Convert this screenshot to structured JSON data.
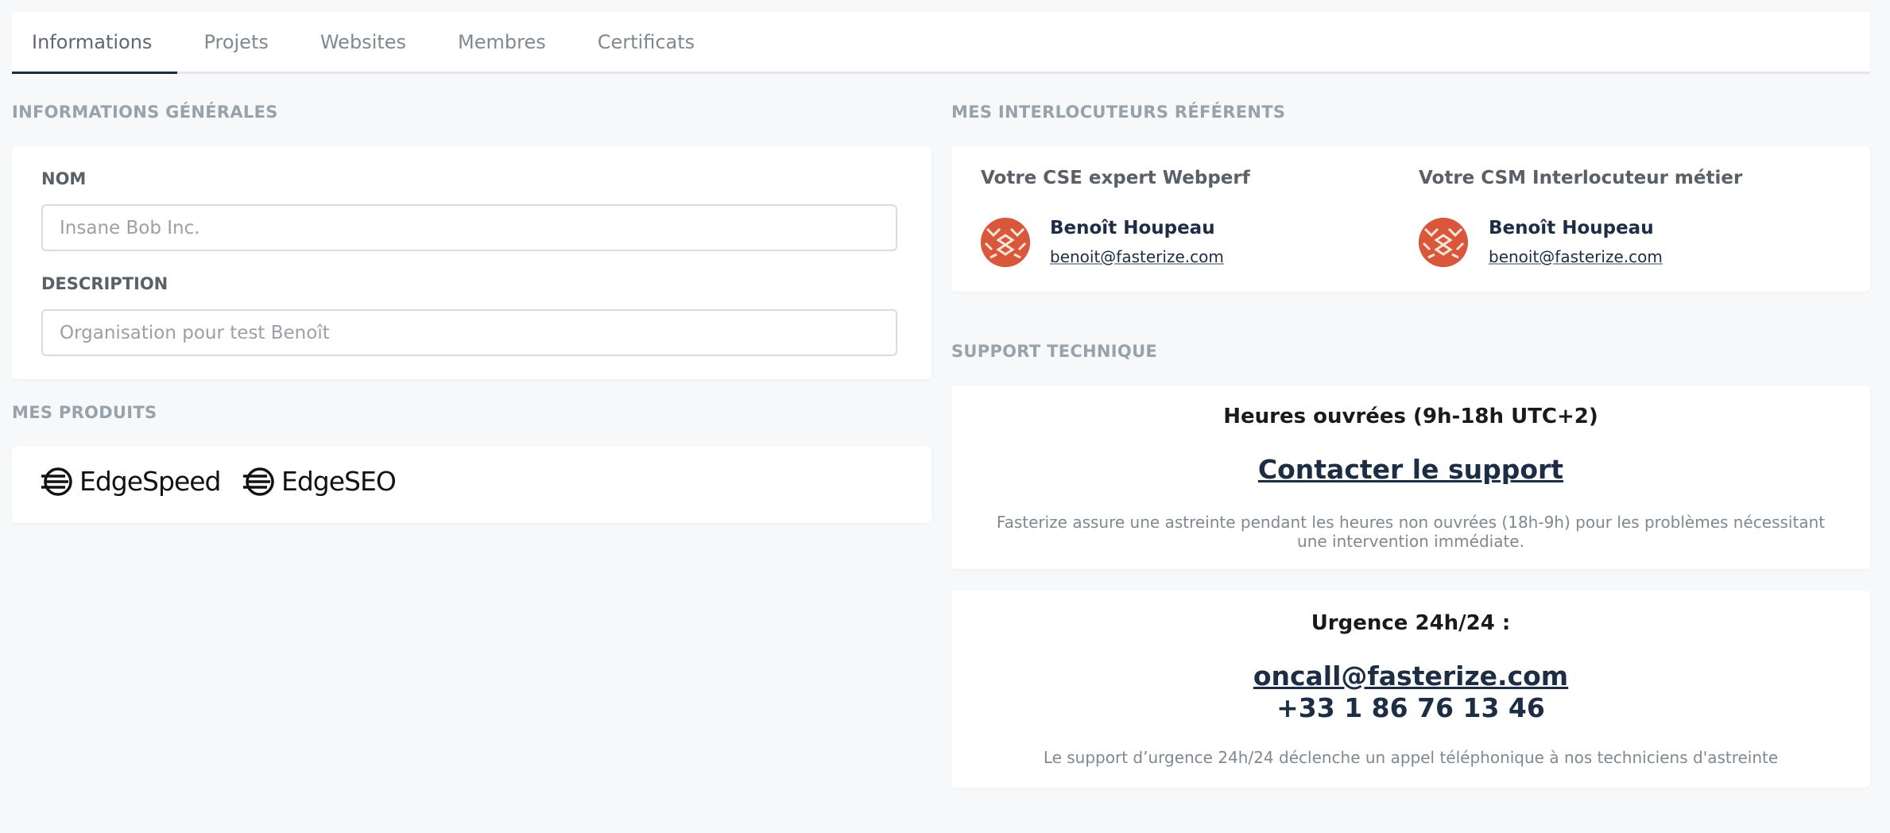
{
  "tabs": [
    "Informations",
    "Projets",
    "Websites",
    "Membres",
    "Certificats"
  ],
  "general": {
    "title": "INFORMATIONS GÉNÉRALES",
    "name_label": "NOM",
    "name_placeholder": "Insane Bob Inc.",
    "description_label": "DESCRIPTION",
    "description_placeholder": "Organisation pour test Benoît"
  },
  "products": {
    "title": "MES PRODUITS",
    "items": [
      "EdgeSpeed",
      "EdgeSEO"
    ]
  },
  "contacts": {
    "title": "MES INTERLOCUTEURS RÉFÉRENTS",
    "items": [
      {
        "role": "Votre CSE expert Webperf",
        "name": "Benoît Houpeau",
        "email": "benoit@fasterize.com"
      },
      {
        "role": "Votre CSM Interlocuteur métier",
        "name": "Benoît Houpeau",
        "email": "benoit@fasterize.com"
      }
    ]
  },
  "support": {
    "title": "SUPPORT TECHNIQUE",
    "business_hours": "Heures ouvrées (9h-18h UTC+2)",
    "contact_link": "Contacter le support",
    "business_note": "Fasterize assure une astreinte pendant les heures non ouvrées (18h-9h) pour les problèmes nécessitant une intervention immédiate.",
    "urgent_title": "Urgence 24h/24 :",
    "urgent_email": "oncall@fasterize.com",
    "urgent_phone": "+33 1 86 76 13 46",
    "urgent_note": "Le support d’urgence 24h/24 déclenche un appel téléphonique à nos techniciens d'astreinte"
  },
  "colors": {
    "accent": "#1c2d44",
    "avatar": "#d9573a",
    "background": "#f7f8fa"
  }
}
